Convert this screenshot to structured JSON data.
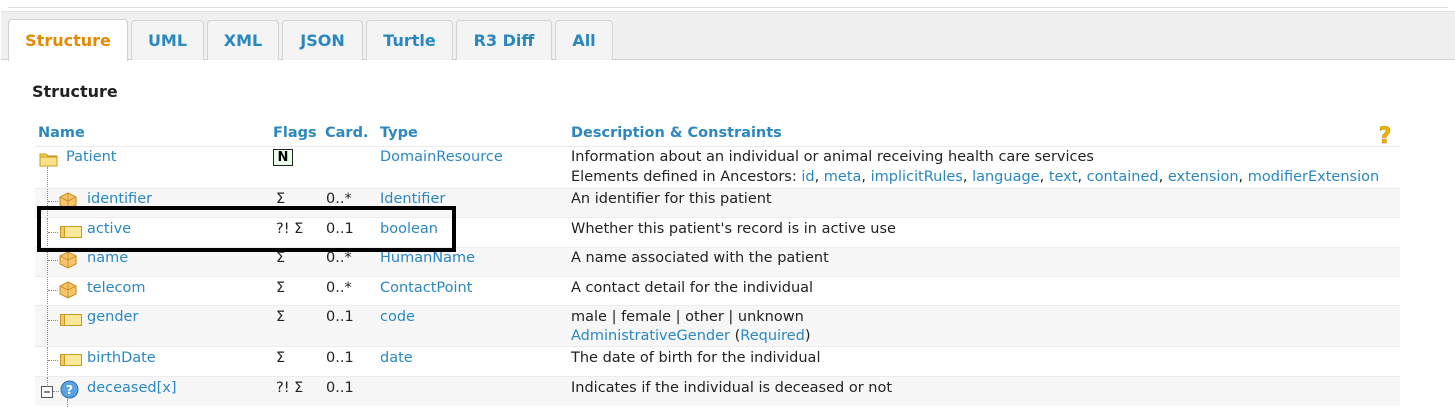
{
  "tabs": [
    "Structure",
    "UML",
    "XML",
    "JSON",
    "Turtle",
    "R3 Diff",
    "All"
  ],
  "active_tab": "Structure",
  "section_title": "Structure",
  "columns": {
    "name": "Name",
    "flags": "Flags",
    "card": "Card.",
    "type": "Type",
    "desc": "Description & Constraints"
  },
  "help_icon": "question-mark",
  "root": {
    "name": "Patient",
    "flag_badge": "N",
    "type": "DomainResource",
    "desc": "Information about an individual or animal receiving health care services",
    "ancestors_prefix": "Elements defined in Ancestors: ",
    "ancestors": [
      "id",
      "meta",
      "implicitRules",
      "language",
      "text",
      "contained",
      "extension",
      "modifierExtension"
    ]
  },
  "rows": [
    {
      "name": "identifier",
      "icon": "datatype",
      "flags": "Σ",
      "card": "0..*",
      "type": "Identifier",
      "desc": "An identifier for this patient"
    },
    {
      "name": "active",
      "icon": "primitive",
      "flags": "?! Σ",
      "card": "0..1",
      "type": "boolean",
      "desc": "Whether this patient's record is in active use"
    },
    {
      "name": "name",
      "icon": "datatype",
      "flags": "Σ",
      "card": "0..*",
      "type": "HumanName",
      "desc": "A name associated with the patient"
    },
    {
      "name": "telecom",
      "icon": "datatype",
      "flags": "Σ",
      "card": "0..*",
      "type": "ContactPoint",
      "desc": "A contact detail for the individual"
    },
    {
      "name": "gender",
      "icon": "primitive",
      "flags": "Σ",
      "card": "0..1",
      "type": "code",
      "desc": "male | female | other | unknown",
      "binding": "AdministrativeGender",
      "binding_strength": "Required"
    },
    {
      "name": "birthDate",
      "icon": "primitive",
      "flags": "Σ",
      "card": "0..1",
      "type": "date",
      "desc": "The date of birth for the individual"
    },
    {
      "name": "deceased[x]",
      "icon": "choice",
      "flags": "?! Σ",
      "card": "0..1",
      "type": "",
      "desc": "Indicates if the individual is deceased or not"
    }
  ]
}
